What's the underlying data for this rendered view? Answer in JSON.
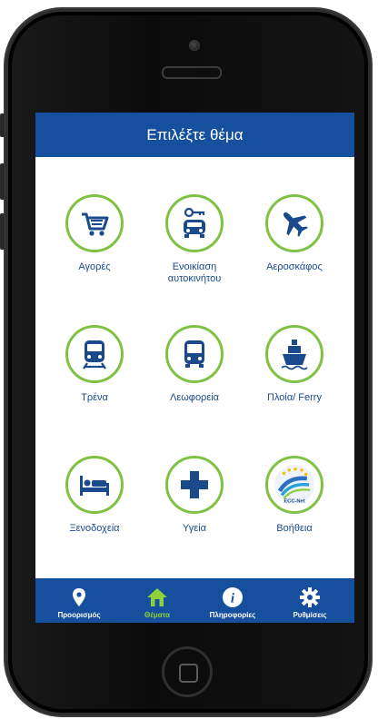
{
  "header": {
    "title": "Επιλέξτε θέμα"
  },
  "topics": [
    {
      "label": "Αγορές",
      "icon": "cart-icon"
    },
    {
      "label": "Ενοικίαση αυτοκινήτου",
      "icon": "car-key-icon"
    },
    {
      "label": "Αεροσκάφος",
      "icon": "airplane-icon"
    },
    {
      "label": "Τρένα",
      "icon": "train-icon"
    },
    {
      "label": "Λεωφορεία",
      "icon": "bus-icon"
    },
    {
      "label": "Πλοία/ Ferry",
      "icon": "ship-icon"
    },
    {
      "label": "Ξενοδοχεία",
      "icon": "bed-icon"
    },
    {
      "label": "Υγεία",
      "icon": "medical-cross-icon"
    },
    {
      "label": "Βοήθεια",
      "icon": "ecc-net-logo",
      "logo_text": "ECC-Net"
    }
  ],
  "tabs": [
    {
      "label": "Προορισμός",
      "icon": "location-pin-icon",
      "active": false
    },
    {
      "label": "Θέματα",
      "icon": "home-icon",
      "active": true
    },
    {
      "label": "Πληροφορίες",
      "icon": "info-icon",
      "active": false
    },
    {
      "label": "Ρυθμίσεις",
      "icon": "gear-icon",
      "active": false
    }
  ],
  "colors": {
    "bar": "#154f9e",
    "icon_blue": "#1a4a8c",
    "ring_green": "#7fc243",
    "active_tab": "#8dd13b"
  }
}
